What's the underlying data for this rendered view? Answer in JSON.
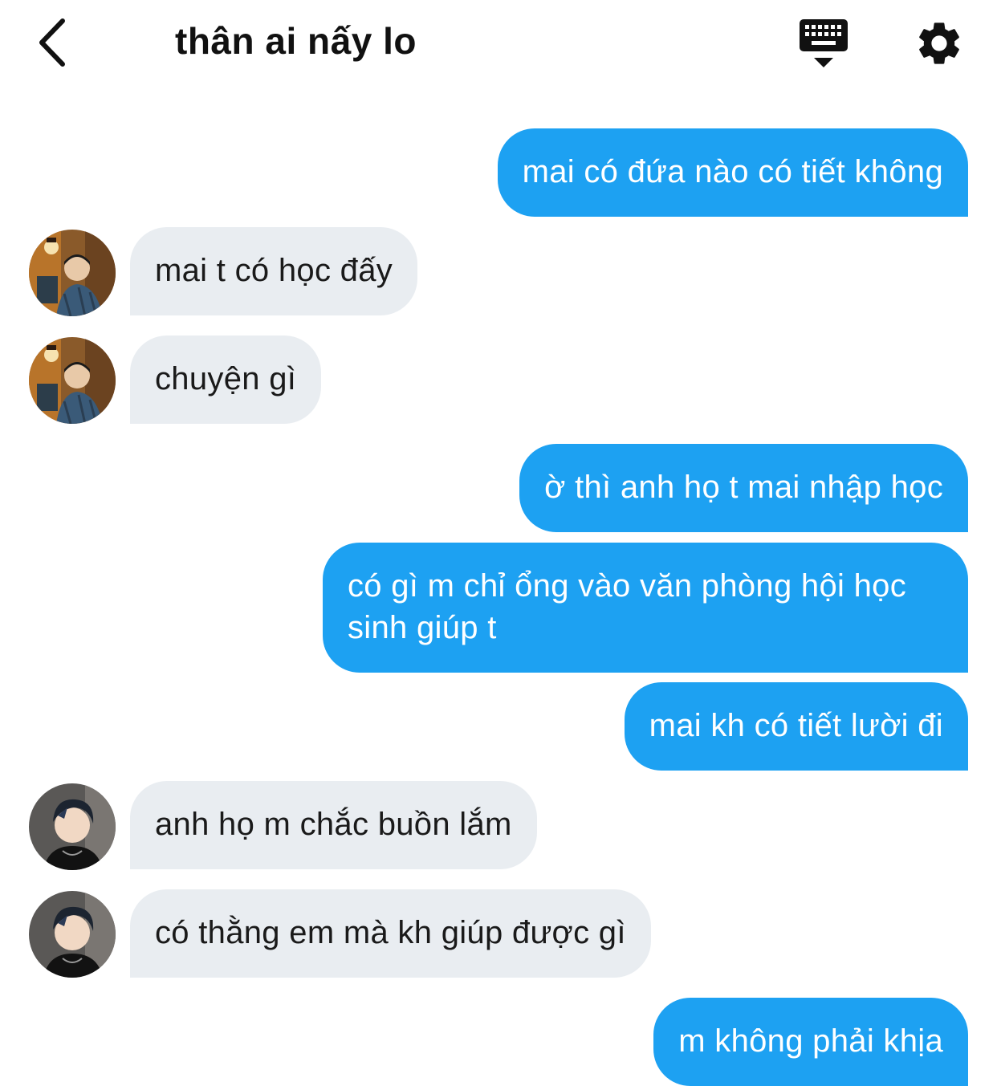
{
  "header": {
    "title": "thân ai nấy lo",
    "back_icon": "chevron-left-icon",
    "keyboard_icon": "keyboard-hide-icon",
    "settings_icon": "gear-icon"
  },
  "colors": {
    "outgoing_bubble": "#1da1f2",
    "incoming_bubble": "#e9edf1",
    "outgoing_text": "#ffffff",
    "incoming_text": "#1a1a1a"
  },
  "messages": [
    {
      "direction": "out",
      "text": "mai có đứa nào có tiết không"
    },
    {
      "direction": "in",
      "sender": "avatar-1",
      "text": "mai t có học đấy"
    },
    {
      "direction": "in",
      "sender": "avatar-1",
      "text": "chuyện gì"
    },
    {
      "direction": "out",
      "text": "ờ thì anh họ t mai nhập học"
    },
    {
      "direction": "out",
      "text": "có gì m chỉ ổng vào văn phòng hội học sinh giúp t"
    },
    {
      "direction": "out",
      "text": "mai kh có tiết lười đi"
    },
    {
      "direction": "in",
      "sender": "avatar-2",
      "text": "anh họ m chắc buồn lắm"
    },
    {
      "direction": "in",
      "sender": "avatar-2",
      "text": "có thằng em mà kh giúp được gì"
    },
    {
      "direction": "out",
      "text": "m không phải khịa"
    }
  ]
}
